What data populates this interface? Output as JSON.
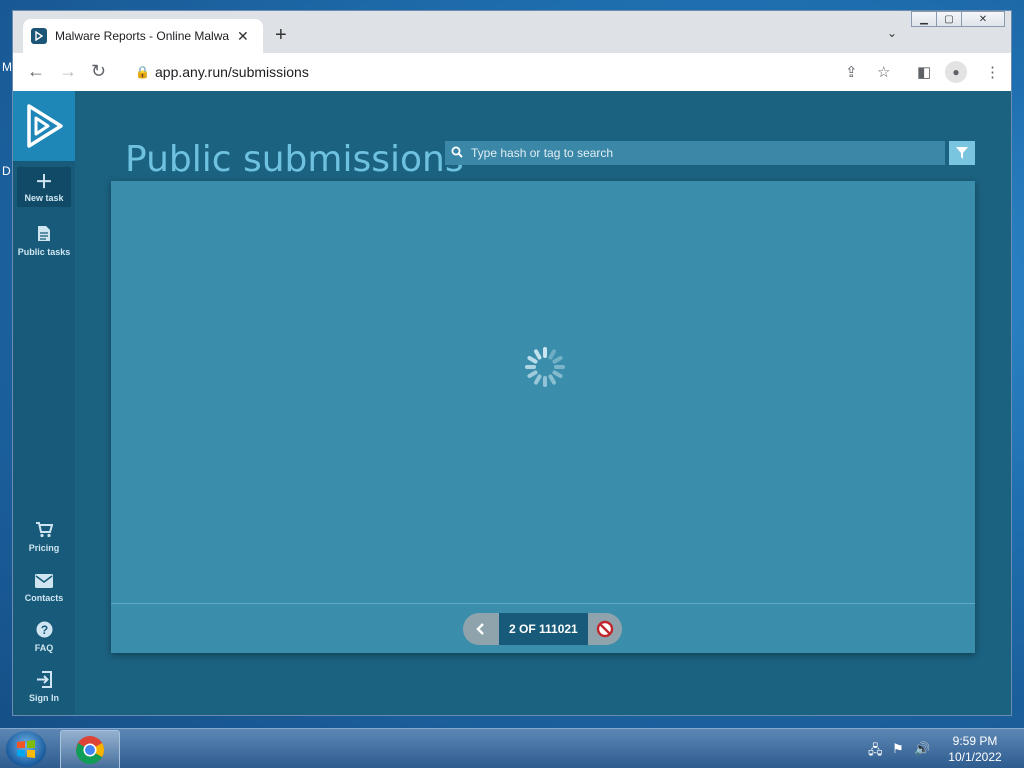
{
  "desktop": {
    "icon_letter_1": "M",
    "icon_letter_2": "D"
  },
  "browser": {
    "tab_title": "Malware Reports - Online Malwa",
    "url": "app.any.run/submissions"
  },
  "sidebar": {
    "items": [
      {
        "label": "New task",
        "icon": "plus-icon"
      },
      {
        "label": "Public tasks",
        "icon": "document-icon"
      },
      {
        "label": "Pricing",
        "icon": "cart-icon"
      },
      {
        "label": "Contacts",
        "icon": "mail-icon"
      },
      {
        "label": "FAQ",
        "icon": "help-icon"
      },
      {
        "label": "Sign In",
        "icon": "sign-in-icon"
      }
    ]
  },
  "page": {
    "title": "Public submissions",
    "search_placeholder": "Type hash or tag to search"
  },
  "pager": {
    "text": "2 OF 111021"
  },
  "taskbar": {
    "time": "9:59 PM",
    "date": "10/1/2022"
  },
  "colors": {
    "accent": "#1e87b8",
    "page_bg": "#1b6180",
    "panel": "#3b8eab"
  }
}
